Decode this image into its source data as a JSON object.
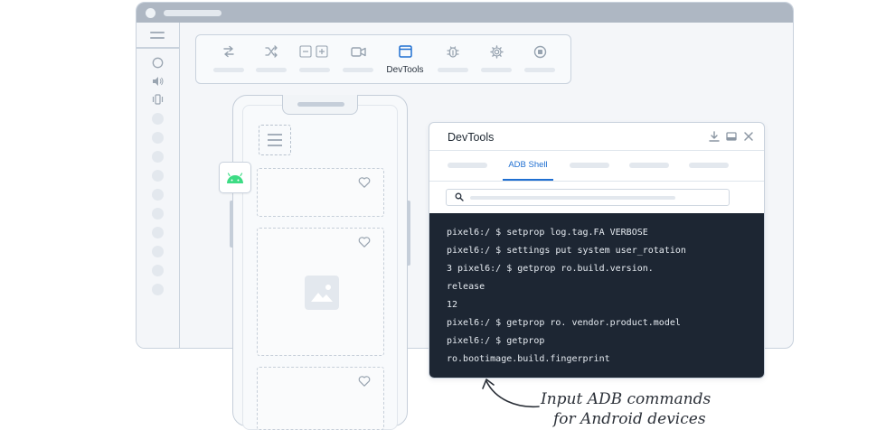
{
  "toolbar": {
    "devtools_label": "DevTools",
    "icons": [
      "swap-arrows",
      "shuffle",
      "zoom-minus-plus",
      "video-camera",
      "window",
      "bug",
      "gear",
      "stop"
    ]
  },
  "devtools": {
    "title": "DevTools",
    "active_tab": "ADB Shell",
    "terminal_lines": [
      "pixel6:/ $ setprop log.tag.FA VERBOSE",
      "pixel6:/ $ settings put system user_rotation",
      "3 pixel6:/ $ getprop ro.build.version.",
      "release",
      "12",
      "pixel6:/ $ getprop ro. vendor.product.model",
      "pixel6:/ $ getprop",
      "ro.bootimage.build.fingerprint"
    ]
  },
  "caption": {
    "line1": "Input ADB commands",
    "line2": "for Android devices"
  },
  "colors": {
    "accent": "#1f6fd1",
    "android_green": "#3ddc84",
    "terminal_bg": "#1d2633",
    "border": "#c9d2dd"
  }
}
